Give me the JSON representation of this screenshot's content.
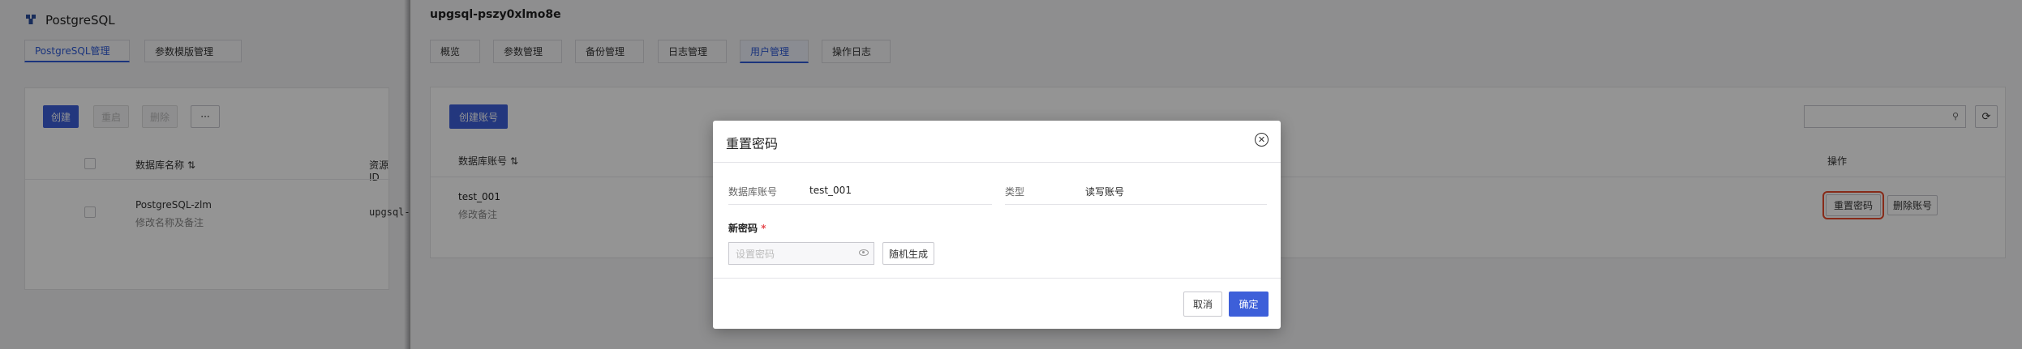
{
  "left_panel": {
    "app_title": "PostgreSQL",
    "tabs": [
      {
        "label": "PostgreSQL管理",
        "active": true
      },
      {
        "label": "参数模版管理",
        "active": false
      }
    ],
    "toolbar": {
      "create": "创建",
      "btn2": "重启",
      "btn3": "删除",
      "more": "···"
    },
    "table": {
      "headers": {
        "name": "数据库名称",
        "resource_id": "资源ID"
      },
      "rows": [
        {
          "name": "PostgreSQL-zlm",
          "sub": "修改名称及备注",
          "resource_id": "upgsql-"
        }
      ]
    }
  },
  "drawer": {
    "title": "upgsql-pszy0xlmo8e",
    "tabs": [
      {
        "label": "概览",
        "active": false
      },
      {
        "label": "参数管理",
        "active": false
      },
      {
        "label": "备份管理",
        "active": false
      },
      {
        "label": "日志管理",
        "active": false
      },
      {
        "label": "用户管理",
        "active": true
      },
      {
        "label": "操作日志",
        "active": false
      }
    ],
    "create_account": "创建账号",
    "search_icon": "search-icon",
    "refresh_icon": "refresh-icon",
    "table": {
      "headers": {
        "account": "数据库账号",
        "ops": "操作"
      },
      "rows": [
        {
          "account": "test_001",
          "remark": "修改备注",
          "reset_pwd": "重置密码",
          "delete": "删除账号"
        }
      ]
    }
  },
  "modal": {
    "title": "重置密码",
    "fields": {
      "account_label": "数据库账号",
      "account_value": "test_001",
      "type_label": "类型",
      "type_value": "读写账号"
    },
    "new_password_label": "新密码",
    "required_mark": "*",
    "password_placeholder": "设置密码",
    "random_button": "随机生成",
    "cancel": "取消",
    "confirm": "确定"
  },
  "colors": {
    "accent": "#3d5fd9",
    "highlight": "#e84b2c"
  }
}
